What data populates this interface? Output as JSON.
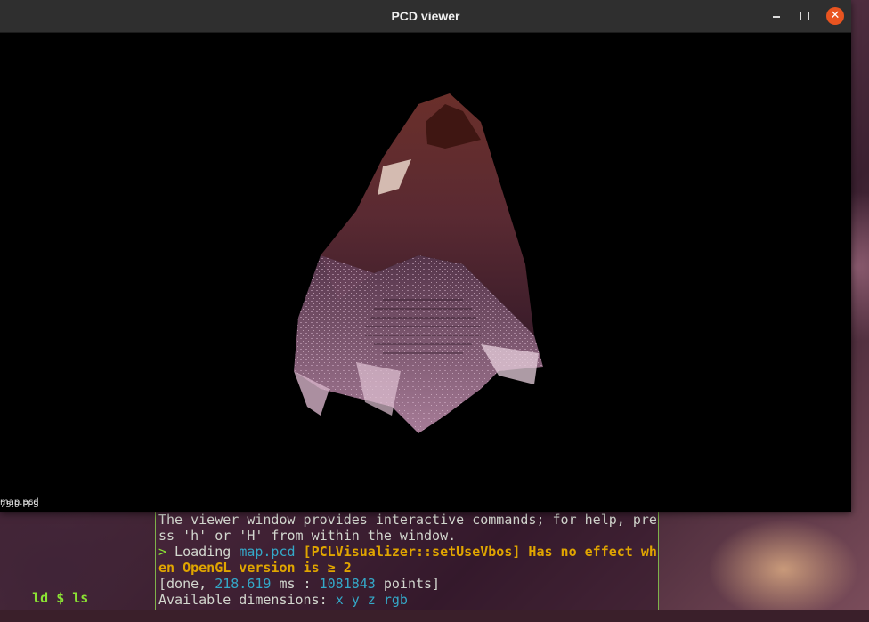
{
  "window": {
    "title": "PCD viewer",
    "minimize_icon": "minimize-icon",
    "maximize_icon": "maximize-icon",
    "close_icon": "close-icon",
    "close_color": "#e95420"
  },
  "viewer": {
    "overlay_filename": "map.pcd",
    "overlay_fps": "75.9 FPS",
    "background_color": "#000000"
  },
  "left_terminal": {
    "line1_prefix": "ld",
    "line1_cmd": "$ ls"
  },
  "terminal": {
    "lines": [
      {
        "text": "The viewer window provides interactive commands; for help, pre"
      },
      {
        "text": "ss 'h' or 'H' from within the window."
      }
    ],
    "loading": {
      "arrow": ">",
      "label": " Loading ",
      "file": "map.pcd",
      "warning_1": " [PCLVisualizer::setUseVbos] Has no effect wh",
      "warning_2": "en OpenGL version is ≥ 2"
    },
    "done": {
      "prefix": "[done, ",
      "ms": "218.619",
      "mid": " ms : ",
      "points": "1081843",
      "suffix": " points]"
    },
    "dims": {
      "label": "Available dimensions: ",
      "values": "x y z rgb"
    }
  }
}
